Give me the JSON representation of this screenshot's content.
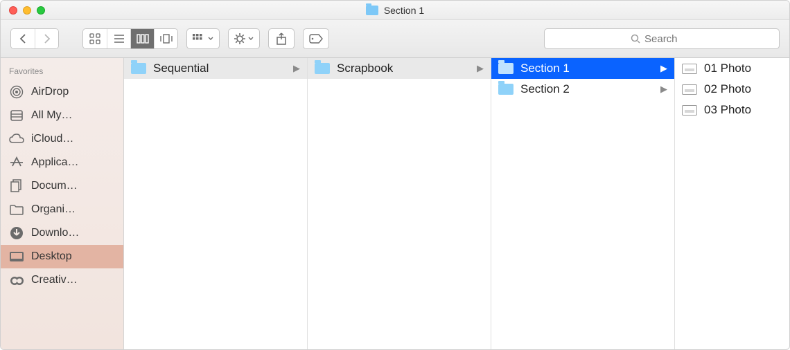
{
  "window": {
    "title": "Section 1"
  },
  "toolbar": {
    "search_placeholder": "Search"
  },
  "sidebar": {
    "header": "Favorites",
    "items": [
      {
        "label": "AirDrop",
        "icon": "airdrop-icon",
        "selected": false
      },
      {
        "label": "All My…",
        "icon": "files-icon",
        "selected": false
      },
      {
        "label": "iCloud…",
        "icon": "cloud-icon",
        "selected": false
      },
      {
        "label": "Applica…",
        "icon": "applications-icon",
        "selected": false
      },
      {
        "label": "Docum…",
        "icon": "documents-icon",
        "selected": false
      },
      {
        "label": "Organi…",
        "icon": "folder-icon",
        "selected": false
      },
      {
        "label": "Downlo…",
        "icon": "downloads-icon",
        "selected": false
      },
      {
        "label": "Desktop",
        "icon": "desktop-icon",
        "selected": true
      },
      {
        "label": "Creativ…",
        "icon": "creative-cloud-icon",
        "selected": false
      }
    ]
  },
  "columns": [
    {
      "items": [
        {
          "name": "Sequential",
          "type": "folder",
          "selected": true,
          "has_children": true
        }
      ]
    },
    {
      "items": [
        {
          "name": "Scrapbook",
          "type": "folder",
          "selected": true,
          "has_children": true
        }
      ]
    },
    {
      "items": [
        {
          "name": "Section 1",
          "type": "folder",
          "selected": true,
          "has_children": true
        },
        {
          "name": "Section 2",
          "type": "folder",
          "selected": false,
          "has_children": true
        }
      ]
    },
    {
      "items": [
        {
          "name": "01 Photo",
          "type": "image-file",
          "selected": false
        },
        {
          "name": "02 Photo",
          "type": "image-file",
          "selected": false
        },
        {
          "name": "03 Photo",
          "type": "image-file",
          "selected": false
        }
      ]
    }
  ],
  "view_mode": "column",
  "colors": {
    "selection": "#0a63ff",
    "sidebar_selection": "#e3b4a3",
    "folder": "#8fd2f9"
  }
}
